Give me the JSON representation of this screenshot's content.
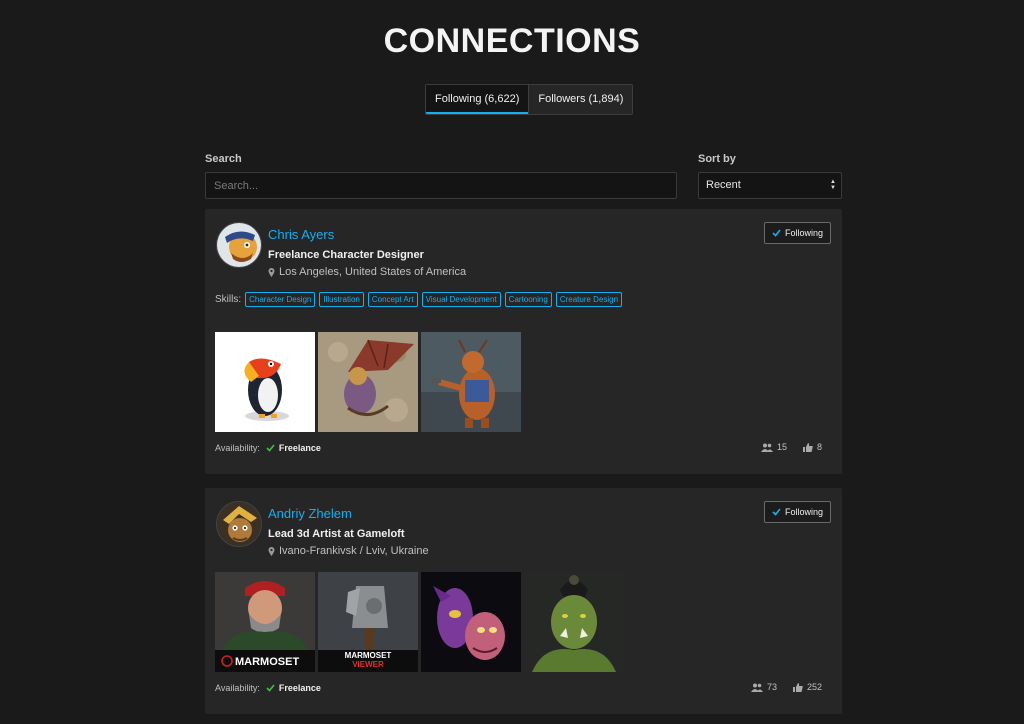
{
  "page": {
    "title": "CONNECTIONS"
  },
  "tabs": [
    {
      "label": "Following (6,622)",
      "active": true
    },
    {
      "label": "Followers (1,894)",
      "active": false
    }
  ],
  "filters": {
    "search_label": "Search",
    "search_placeholder": "Search...",
    "sort_label": "Sort by",
    "sort_value": "Recent"
  },
  "labels": {
    "skills": "Skills:",
    "availability": "Availability:"
  },
  "accent_color": "#13aff0",
  "users": [
    {
      "name": "Chris Ayers",
      "headline": "Freelance Character Designer",
      "location": "Los Angeles, United States of America",
      "follow_label": "Following",
      "skills": [
        "Character Design",
        "Illustration",
        "Concept Art",
        "Visual Development",
        "Cartooning",
        "Creature Design"
      ],
      "availability": "Freelance",
      "followers": "15",
      "likes": "8"
    },
    {
      "name": "Andriy Zhelem",
      "headline": "Lead 3d Artist at Gameloft",
      "location": "Ivano-Frankivsk / Lviv, Ukraine",
      "follow_label": "Following",
      "availability": "Freelance",
      "followers": "73",
      "likes": "252",
      "thumb_captions": [
        "MARMOSET",
        "MARMOSET",
        "VIEWER"
      ]
    }
  ]
}
